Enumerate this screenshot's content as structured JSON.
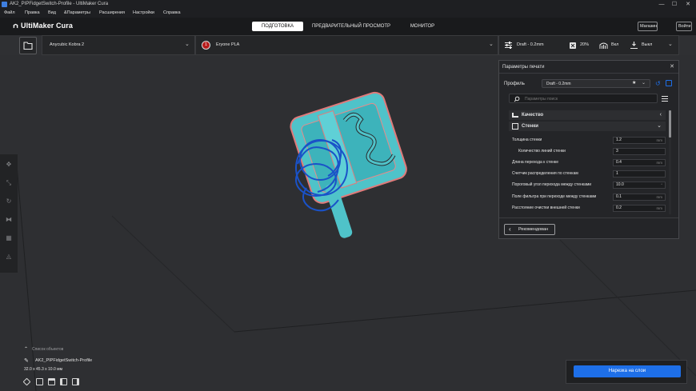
{
  "window": {
    "title": "AK2_PIPFidgetSwitch-Profile - UltiMaker Cura"
  },
  "menu": [
    "Файл",
    "Правка",
    "Вид",
    "&Параметры",
    "Расширения",
    "Настройки",
    "Справка"
  ],
  "header": {
    "logo": "UltiMaker Cura",
    "tabs": [
      "ПОДГОТОВКА",
      "ПРЕДВАРИТЕЛЬНЫЙ ПРОСМОТР",
      "МОНИТОР"
    ],
    "active_tab": "ПОДГОТОВКА",
    "marketplace": "Магазин",
    "signin": "Войти"
  },
  "stage": {
    "printer": "Anycubic Kobra 2",
    "extruder_number": "1",
    "material": "Eryone PLA",
    "profile_summary": "Draft - 0.2mm",
    "infill": "20%",
    "support": "Вкл",
    "adhesion": "Выкл"
  },
  "print_settings": {
    "title": "Параметры печати",
    "profile_label": "Профиль",
    "profile_value": "Draft - 0.2mm",
    "search_placeholder": "Параметры поиск",
    "categories": {
      "quality": "Качество",
      "walls": "Стенки"
    },
    "settings": [
      {
        "label": "Толщина стенки",
        "value": "1.2",
        "unit": "mm"
      },
      {
        "label": "Количество линий стенки",
        "value": "3",
        "unit": ""
      },
      {
        "label": "Длина перехода к стенке",
        "value": "0.4",
        "unit": "mm"
      },
      {
        "label": "Счетчик распределения по стенкам",
        "value": "1",
        "unit": ""
      },
      {
        "label": "Пороговый угол перехода между стенками",
        "value": "10.0",
        "unit": "°"
      },
      {
        "label": "Поле фильтра при переходе между стенками",
        "value": "0.1",
        "unit": "mm"
      },
      {
        "label": "Расстояние очистки внешней стенки",
        "value": "0.2",
        "unit": "mm"
      }
    ],
    "recommended_button": "Рекомендован"
  },
  "object_list": {
    "header": "Список объектов",
    "object_name": "AK2_PIPFidgetSwitch-Profile",
    "dimensions": "32.0 x 45.3 x 10.0 мм"
  },
  "slice_button": "Нарезка на слои",
  "colors": {
    "accent": "#1e6fe8",
    "model": "#4fc3c9",
    "model_outline": "#e07a7a",
    "support": "#1a52c8"
  }
}
